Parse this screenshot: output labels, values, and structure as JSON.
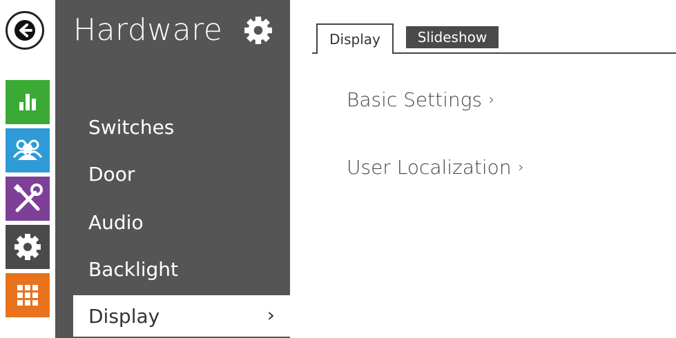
{
  "rail": {
    "back_icon": "arrow-left-icon",
    "tiles": [
      {
        "name": "stats",
        "icon": "bar-chart-icon",
        "color": "#3aaa35"
      },
      {
        "name": "users",
        "icon": "users-icon",
        "color": "#2e9bd6"
      },
      {
        "name": "services",
        "icon": "tools-icon",
        "color": "#7d3f98"
      },
      {
        "name": "hardware",
        "icon": "gear-icon",
        "color": "#4a4a4a"
      },
      {
        "name": "system",
        "icon": "grid-icon",
        "color": "#e8731c"
      }
    ]
  },
  "sidebar": {
    "title": "Hardware",
    "title_icon": "gear-icon",
    "items": [
      {
        "label": "Switches"
      },
      {
        "label": "Door"
      },
      {
        "label": "Audio"
      },
      {
        "label": "Backlight"
      },
      {
        "label": "Display",
        "active": true,
        "chevron": "›"
      }
    ]
  },
  "tabs": [
    {
      "label": "Display",
      "active": true
    },
    {
      "label": "Slideshow",
      "active": false
    }
  ],
  "sections": [
    {
      "label": "Basic Settings",
      "arrow": "›"
    },
    {
      "label": "User Localization",
      "arrow": "›"
    }
  ]
}
